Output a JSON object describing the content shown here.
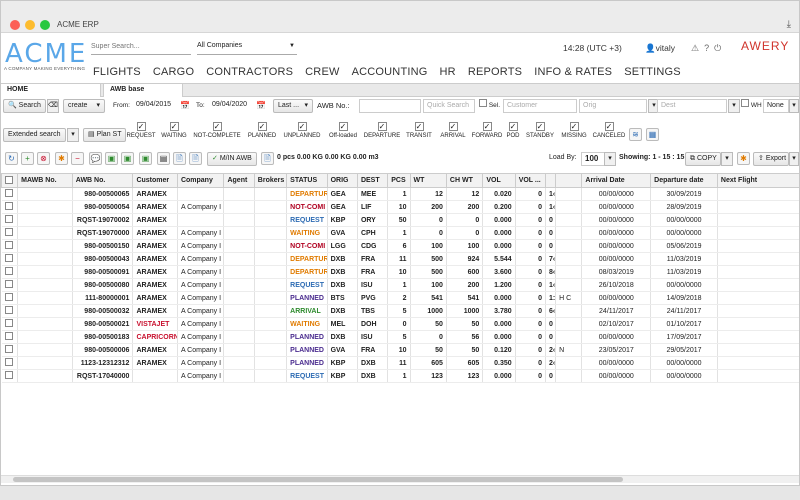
{
  "window": {
    "title": "ACME ERP"
  },
  "brand": {
    "logo": "ACME",
    "tagline": "A COMPANY MAKING EVERYTHING",
    "partner_logo": "AWERY"
  },
  "header": {
    "search_placeholder": "Super Search...",
    "company_select": "All Companies",
    "time": "14:28 (UTC +3)",
    "user": "vitaly"
  },
  "nav": [
    "FLIGHTS",
    "CARGO",
    "CONTRACTORS",
    "CREW",
    "ACCOUNTING",
    "HR",
    "REPORTS",
    "INFO & RATES",
    "SETTINGS"
  ],
  "tabs": {
    "home": "HOME",
    "awb": "AWB base"
  },
  "filters": {
    "search_label": "Search",
    "create_label": "create",
    "from_label": "From:",
    "from_value": "09/04/2015",
    "to_label": "To:",
    "to_value": "09/04/2020",
    "period_label": "Last ...",
    "awb_label": "AWB No.:",
    "quick_search_placeholder": "Quick Search",
    "sel_label": "Sel.",
    "customer_placeholder": "Customer",
    "orig_placeholder": "Orig",
    "dest_placeholder": "Dest",
    "wh_label": "WH",
    "none_label": "None",
    "extended_search": "Extended search",
    "plan_st": "Plan ST"
  },
  "statuses": [
    "REQUEST",
    "WAITING",
    "NOT-COMPLETE",
    "PLANNED",
    "UNPLANNED",
    "Off-loaded",
    "DEPARTURE",
    "TRANSIT",
    "ARRIVAL",
    "FORWARD",
    "POD",
    "STANDBY",
    "MISSING",
    "CANCELED"
  ],
  "toolbar": {
    "mawb_button": "M/IN AWB",
    "summary": "0 pcs 0.00 KG 0.00 KG 0.00 m3",
    "load_by_label": "Load By:",
    "load_by_value": "100",
    "showing": "Showing: 1 - 15 : 15",
    "copy_label": "COPY",
    "export_label": "Export"
  },
  "table": {
    "columns": [
      "MAWB No.",
      "AWB No.",
      "Customer",
      "Company",
      "Agent",
      "Brokers",
      "STATUS",
      "ORIG",
      "DEST",
      "PCS",
      "WT",
      "CH WT",
      "VOL",
      "VOL ...",
      "",
      "",
      "Arrival Date",
      "Departure date",
      "Next Flight"
    ],
    "rows": [
      {
        "awb": "980-00500065",
        "customer": "ARAMEX",
        "company": "",
        "status": "DEPARTUR",
        "status_color": "#e07b00",
        "orig": "GEA",
        "dest": "MEE",
        "pcs": "1",
        "wt": "12",
        "chwt": "12",
        "vol": "0.020",
        "volx": "0",
        "e1": "1‹",
        "e2": "",
        "arr": "00/00/0000",
        "dep": "30/09/2019",
        "next": ""
      },
      {
        "awb": "980-00500054",
        "customer": "ARAMEX",
        "company": "A Company I",
        "status": "NOT-COMI",
        "status_color": "#b00020",
        "orig": "GEA",
        "dest": "LIF",
        "pcs": "10",
        "wt": "200",
        "chwt": "200",
        "vol": "0.200",
        "volx": "0",
        "e1": "1‹",
        "e2": "",
        "arr": "00/00/0000",
        "dep": "28/09/2019",
        "next": ""
      },
      {
        "awb": "RQST-19070002",
        "customer": "ARAMEX",
        "company": "",
        "status": "REQUEST",
        "status_color": "#2d6bb3",
        "orig": "KBP",
        "dest": "ORY",
        "pcs": "50",
        "wt": "0",
        "chwt": "0",
        "vol": "0.000",
        "volx": "0",
        "e1": "0",
        "e2": "",
        "arr": "00/00/0000",
        "dep": "00/00/0000",
        "next": ""
      },
      {
        "awb": "RQST-19070000",
        "customer": "ARAMEX",
        "company": "A Company I",
        "status": "WAITING",
        "status_color": "#e07b00",
        "orig": "GVA",
        "dest": "CPH",
        "pcs": "1",
        "wt": "0",
        "chwt": "0",
        "vol": "0.000",
        "volx": "0",
        "e1": "0",
        "e2": "",
        "arr": "00/00/0000",
        "dep": "00/00/0000",
        "next": ""
      },
      {
        "awb": "980-00500150",
        "customer": "ARAMEX",
        "company": "A Company I",
        "status": "NOT-COMI",
        "status_color": "#b00020",
        "orig": "LGG",
        "dest": "CDG",
        "pcs": "6",
        "wt": "100",
        "chwt": "100",
        "vol": "0.000",
        "volx": "0",
        "e1": "0",
        "e2": "",
        "arr": "00/00/0000",
        "dep": "05/06/2019",
        "next": ""
      },
      {
        "awb": "980-00500043",
        "customer": "ARAMEX",
        "company": "A Company I",
        "status": "DEPARTUR",
        "status_color": "#e07b00",
        "orig": "DXB",
        "dest": "FRA",
        "pcs": "11",
        "wt": "500",
        "chwt": "924",
        "vol": "5.544",
        "volx": "0",
        "e1": "7‹",
        "e2": "",
        "arr": "00/00/0000",
        "dep": "11/03/2019",
        "next": ""
      },
      {
        "awb": "980-00500091",
        "customer": "ARAMEX",
        "company": "A Company I",
        "status": "DEPARTUR",
        "status_color": "#e07b00",
        "orig": "DXB",
        "dest": "FRA",
        "pcs": "10",
        "wt": "500",
        "chwt": "600",
        "vol": "3.600",
        "volx": "0",
        "e1": "8‹",
        "e2": "",
        "arr": "08/03/2019",
        "dep": "11/03/2019",
        "next": ""
      },
      {
        "awb": "980-00500080",
        "customer": "ARAMEX",
        "company": "A Company I",
        "status": "REQUEST",
        "status_color": "#2d6bb3",
        "orig": "DXB",
        "dest": "ISU",
        "pcs": "1",
        "wt": "100",
        "chwt": "200",
        "vol": "1.200",
        "volx": "0",
        "e1": "1‹",
        "e2": "",
        "arr": "26/10/2018",
        "dep": "00/00/0000",
        "next": ""
      },
      {
        "awb": "111-80000001",
        "customer": "ARAMEX",
        "company": "A Company I",
        "status": "PLANNED",
        "status_color": "#4b2d8f",
        "orig": "BTS",
        "dest": "PVG",
        "pcs": "2",
        "wt": "541",
        "chwt": "541",
        "vol": "0.000",
        "volx": "0",
        "e1": "1:",
        "e2": "H  C",
        "arr": "00/00/0000",
        "dep": "14/09/2018",
        "next": ""
      },
      {
        "awb": "980-00500032",
        "customer": "ARAMEX",
        "company": "A Company I",
        "status": "ARRIVAL",
        "status_color": "#2e8b2e",
        "orig": "DXB",
        "dest": "TBS",
        "pcs": "5",
        "wt": "1000",
        "chwt": "1000",
        "vol": "3.780",
        "volx": "0",
        "e1": "6‹",
        "e2": "",
        "arr": "24/11/2017",
        "dep": "24/11/2017",
        "next": ""
      },
      {
        "awb": "980-00500021",
        "customer": "VISTAJET",
        "company": "A Company I",
        "status": "WAITING",
        "status_color": "#e07b00",
        "orig": "MEL",
        "dest": "DOH",
        "pcs": "0",
        "wt": "50",
        "chwt": "50",
        "vol": "0.000",
        "volx": "0",
        "e1": "0",
        "e2": "",
        "arr": "02/10/2017",
        "dep": "01/10/2017",
        "next": ""
      },
      {
        "awb": "980-00500183",
        "customer": "CAPRICORN",
        "company": "A Company I",
        "status": "PLANNED",
        "status_color": "#4b2d8f",
        "orig": "DXB",
        "dest": "ISU",
        "pcs": "5",
        "wt": "0",
        "chwt": "56",
        "vol": "0.000",
        "volx": "0",
        "e1": "0",
        "e2": "",
        "arr": "00/00/0000",
        "dep": "17/09/2017",
        "next": ""
      },
      {
        "awb": "980-00500006",
        "customer": "ARAMEX",
        "company": "A Company I",
        "status": "PLANNED",
        "status_color": "#4b2d8f",
        "orig": "GVA",
        "dest": "FRA",
        "pcs": "10",
        "wt": "50",
        "chwt": "50",
        "vol": "0.120",
        "volx": "0",
        "e1": "2‹",
        "e2": "N",
        "arr": "23/05/2017",
        "dep": "29/05/2017",
        "next": ""
      },
      {
        "awb": "1123-12312312",
        "customer": "ARAMEX",
        "company": "A Company I",
        "status": "PLANNED",
        "status_color": "#4b2d8f",
        "orig": "KBP",
        "dest": "DXB",
        "pcs": "11",
        "wt": "605",
        "chwt": "605",
        "vol": "0.350",
        "volx": "0",
        "e1": "2‹",
        "e2": "",
        "arr": "00/00/0000",
        "dep": "00/00/0000",
        "next": ""
      },
      {
        "awb": "RQST-17040000",
        "customer": "",
        "company": "A Company I",
        "status": "REQUEST",
        "status_color": "#2d6bb3",
        "orig": "KBP",
        "dest": "DXB",
        "pcs": "1",
        "wt": "123",
        "chwt": "123",
        "vol": "0.000",
        "volx": "0",
        "e1": "0",
        "e2": "",
        "arr": "00/00/0000",
        "dep": "00/00/0000",
        "next": ""
      }
    ]
  },
  "colors": {
    "customer_red": "#c8102e"
  }
}
